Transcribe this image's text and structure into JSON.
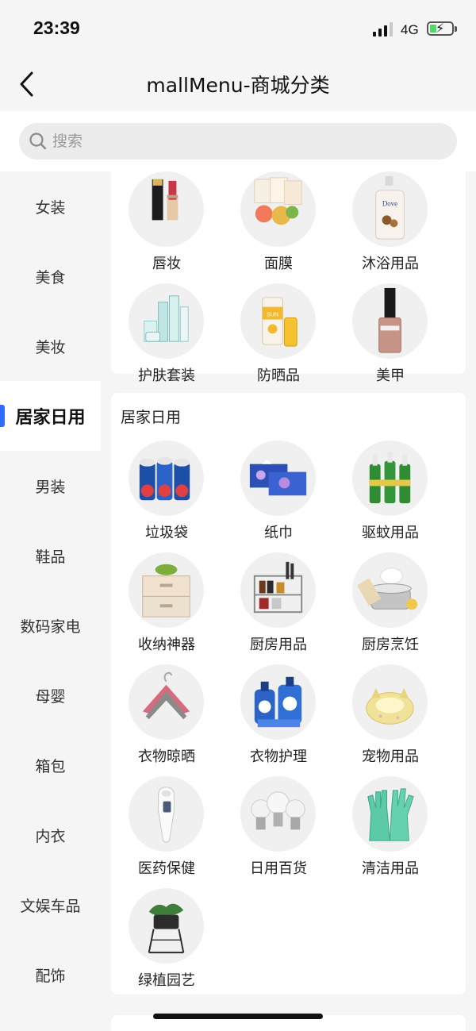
{
  "status_bar": {
    "time": "23:39",
    "network": "4G",
    "battery_level": 0.3,
    "signal_bars": 3
  },
  "nav": {
    "title": "mallMenu-商城分类",
    "back_icon": "chevron-left-icon"
  },
  "search": {
    "placeholder": "搜索",
    "value": ""
  },
  "sidebar": {
    "active_index": 3,
    "accent_color": "#2f6bff",
    "items": [
      {
        "label": "女装"
      },
      {
        "label": "美食"
      },
      {
        "label": "美妆"
      },
      {
        "label": "居家日用"
      },
      {
        "label": "男装"
      },
      {
        "label": "鞋品"
      },
      {
        "label": "数码家电"
      },
      {
        "label": "母婴"
      },
      {
        "label": "箱包"
      },
      {
        "label": "内衣"
      },
      {
        "label": "文娱车品"
      },
      {
        "label": "配饰"
      }
    ]
  },
  "sections": [
    {
      "title": "",
      "items": [
        {
          "label": "唇妆",
          "icon": "lipstick-icon"
        },
        {
          "label": "面膜",
          "icon": "face-mask-icon"
        },
        {
          "label": "沐浴用品",
          "icon": "body-wash-icon"
        },
        {
          "label": "护肤套装",
          "icon": "skincare-set-icon"
        },
        {
          "label": "防晒品",
          "icon": "sunscreen-icon"
        },
        {
          "label": "美甲",
          "icon": "nail-polish-icon"
        }
      ]
    },
    {
      "title": "居家日用",
      "items": [
        {
          "label": "垃圾袋",
          "icon": "trash-bag-icon"
        },
        {
          "label": "纸巾",
          "icon": "tissue-icon"
        },
        {
          "label": "驱蚊用品",
          "icon": "mosquito-repellent-icon"
        },
        {
          "label": "收纳神器",
          "icon": "storage-box-icon"
        },
        {
          "label": "厨房用品",
          "icon": "kitchen-rack-icon"
        },
        {
          "label": "厨房烹饪",
          "icon": "cooking-pot-icon"
        },
        {
          "label": "衣物晾晒",
          "icon": "hanger-icon"
        },
        {
          "label": "衣物护理",
          "icon": "laundry-detergent-icon"
        },
        {
          "label": "宠物用品",
          "icon": "pet-bed-icon"
        },
        {
          "label": "医药保健",
          "icon": "thermometer-icon"
        },
        {
          "label": "日用百货",
          "icon": "light-bulb-icon"
        },
        {
          "label": "清洁用品",
          "icon": "rubber-gloves-icon"
        },
        {
          "label": "绿植园艺",
          "icon": "potted-plant-icon"
        }
      ]
    },
    {
      "title": "",
      "items": []
    }
  ]
}
